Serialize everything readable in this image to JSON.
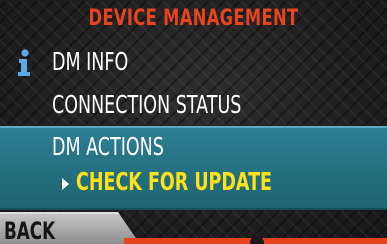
{
  "header": {
    "title": "DEVICE MANAGEMENT"
  },
  "menu": {
    "items": [
      {
        "label": "DM INFO",
        "icon": "info-icon"
      },
      {
        "label": "CONNECTION STATUS"
      },
      {
        "label": "DM ACTIONS",
        "selected": true
      }
    ],
    "submenu": {
      "label": "CHECK FOR UPDATE",
      "highlight_color": "#ffe01a"
    }
  },
  "footer": {
    "back_label": "BACK"
  },
  "colors": {
    "title": "#e8431f",
    "selection_bg": "#2a7a8c",
    "accent_orange": "#e8431f"
  }
}
